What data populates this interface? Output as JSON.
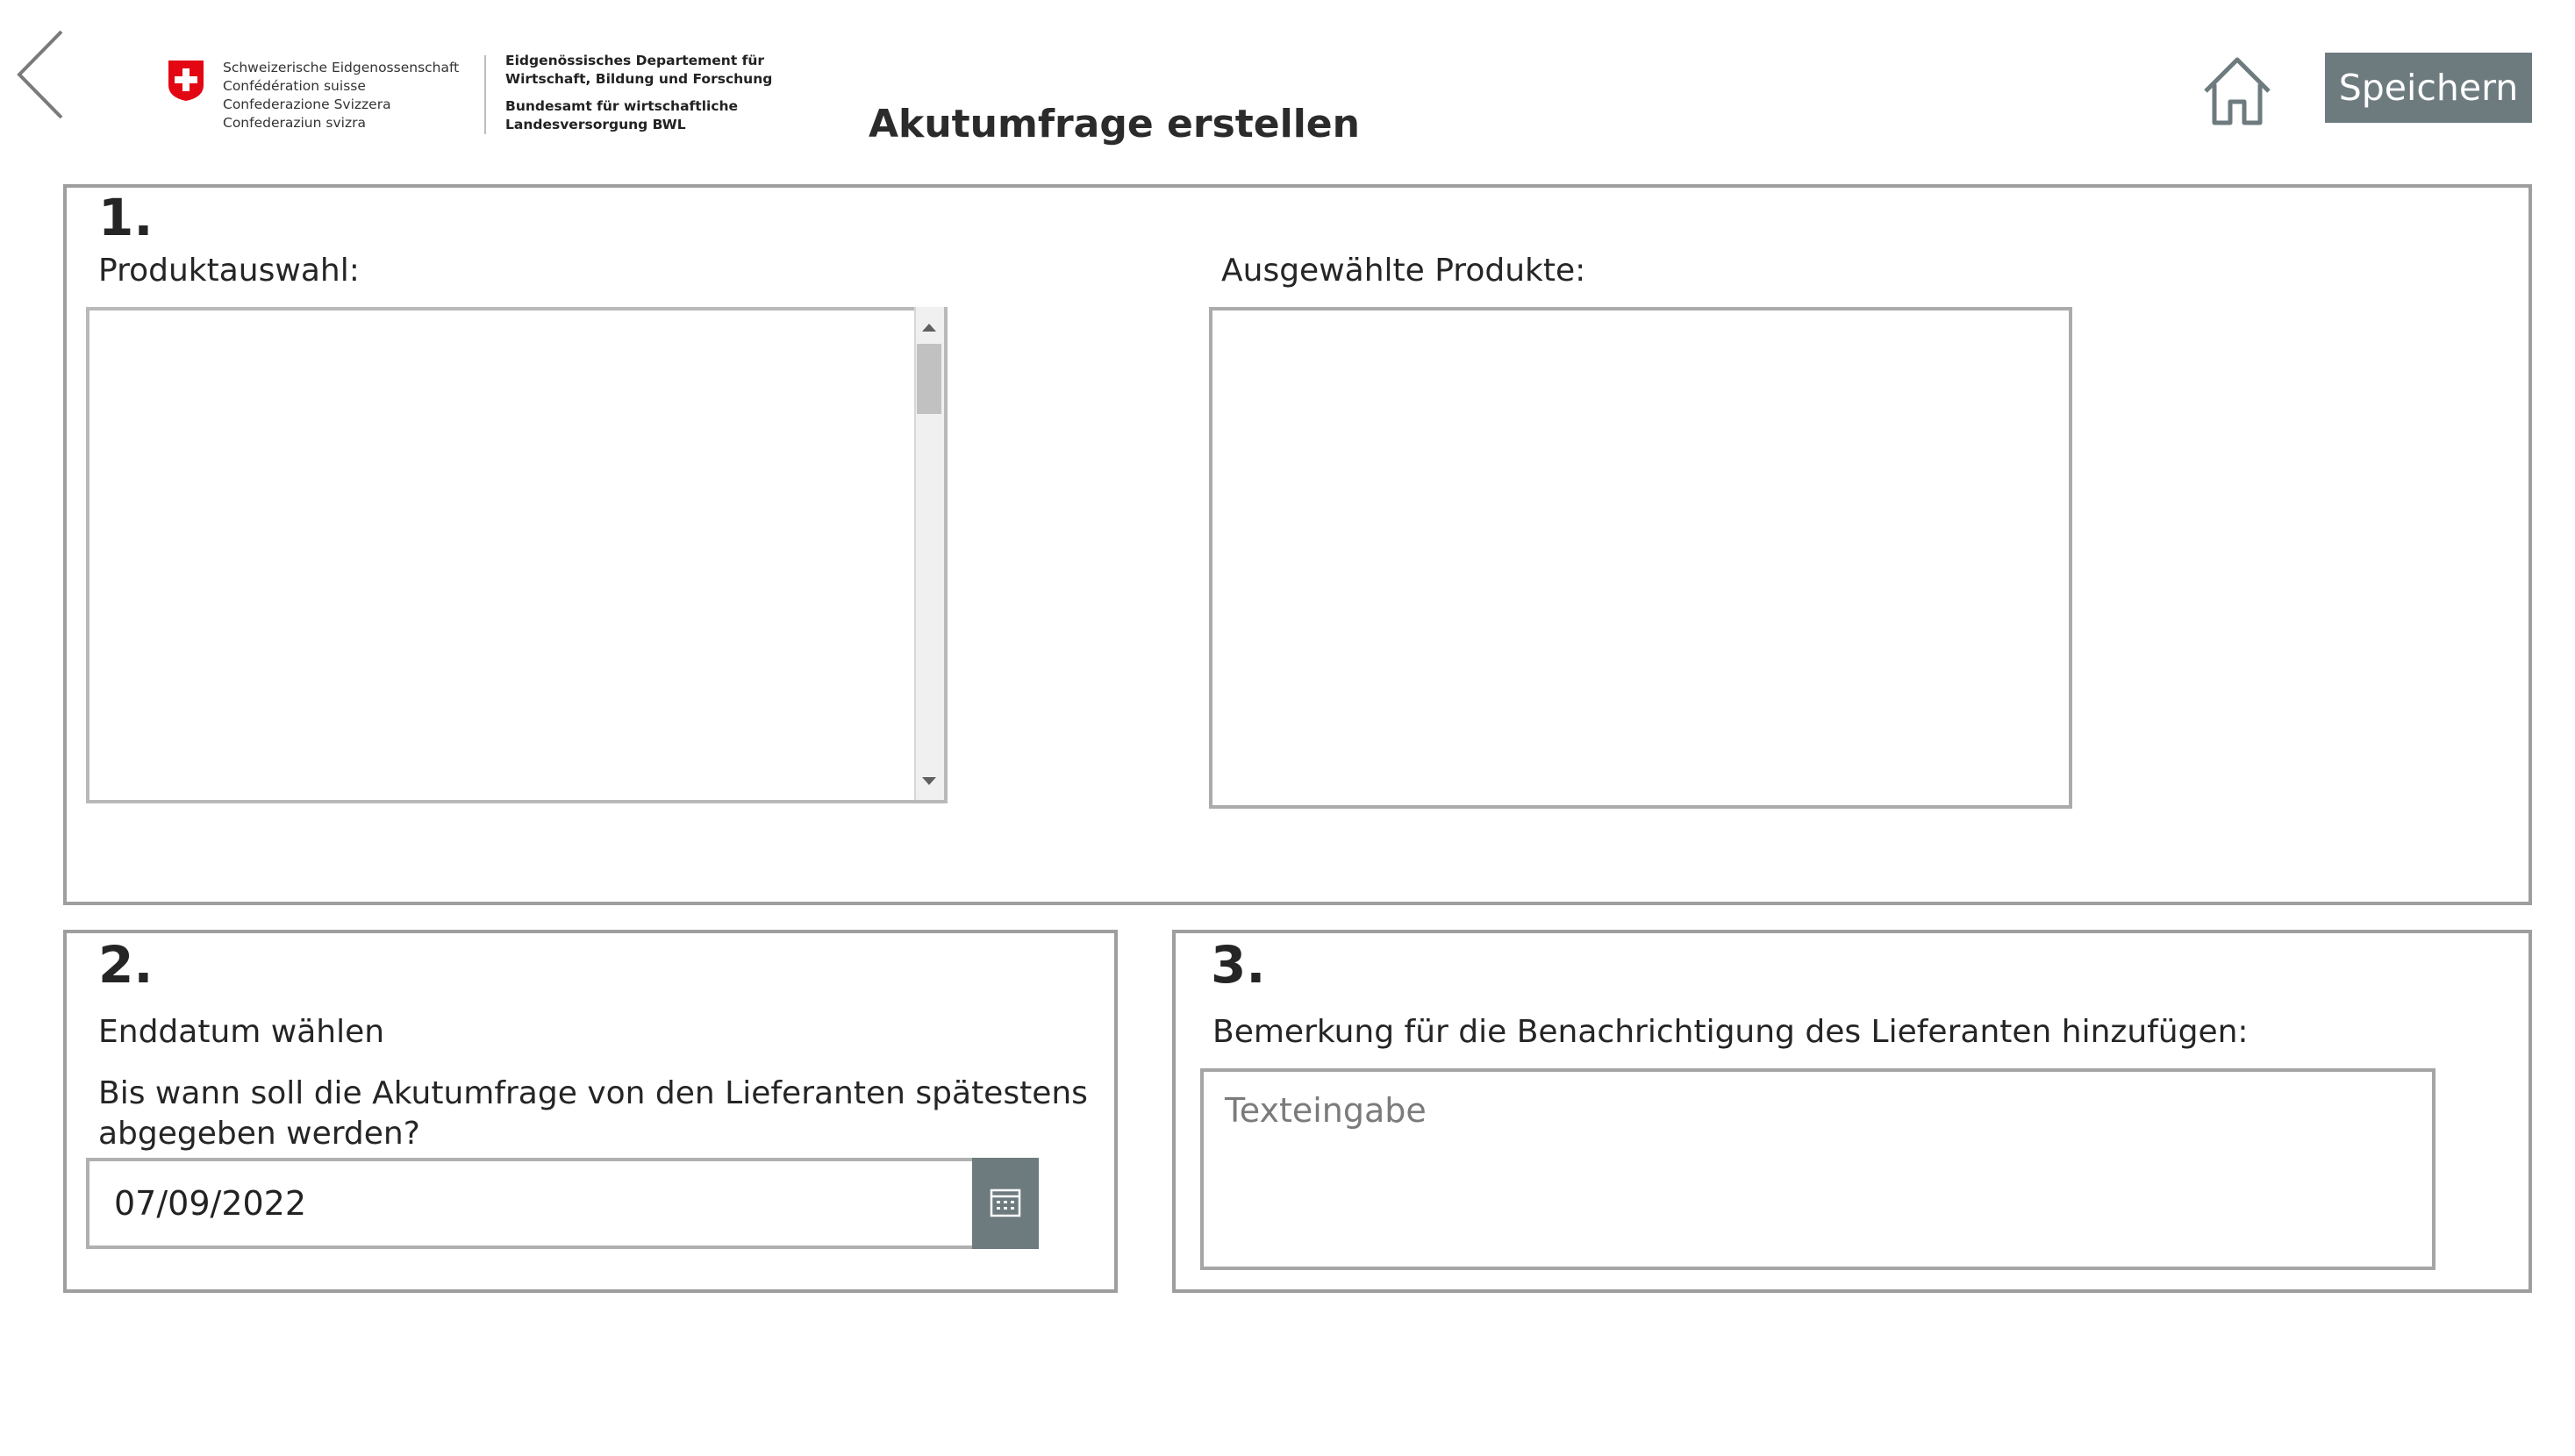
{
  "header": {
    "title": "Akutumfrage erstellen",
    "save_label": "Speichern",
    "back_icon": "chevron-left-icon",
    "home_icon": "home-icon"
  },
  "logo": {
    "confederation_lines": [
      "Schweizerische Eidgenossenschaft",
      "Confédération suisse",
      "Confederazione Svizzera",
      "Confederaziun svizra"
    ],
    "department_lines": [
      "Eidgenössisches Departement für",
      "Wirtschaft, Bildung und Forschung"
    ],
    "office_lines": [
      "Bundesamt für wirtschaftliche",
      "Landesversorgung BWL"
    ],
    "flag_color": "#ff0000"
  },
  "section1": {
    "number": "1.",
    "product_selection_label": "Produktauswahl:",
    "selected_products_label": "Ausgewählte Produkte:"
  },
  "section2": {
    "number": "2.",
    "heading": "Enddatum wählen",
    "question_line1": "Bis wann soll die Akutumfrage von den Lieferanten spätestens",
    "question_line2": "abgegeben werden?",
    "date_value": "07/09/2022",
    "calendar_icon": "calendar-icon"
  },
  "section3": {
    "number": "3.",
    "heading": "Bemerkung für die Benachrichtigung des Lieferanten hinzufügen:",
    "remark_placeholder": "Texteingabe"
  },
  "colors": {
    "accent": "#6d7b7f",
    "panel_border": "#9e9e9e",
    "text": "#252525"
  }
}
